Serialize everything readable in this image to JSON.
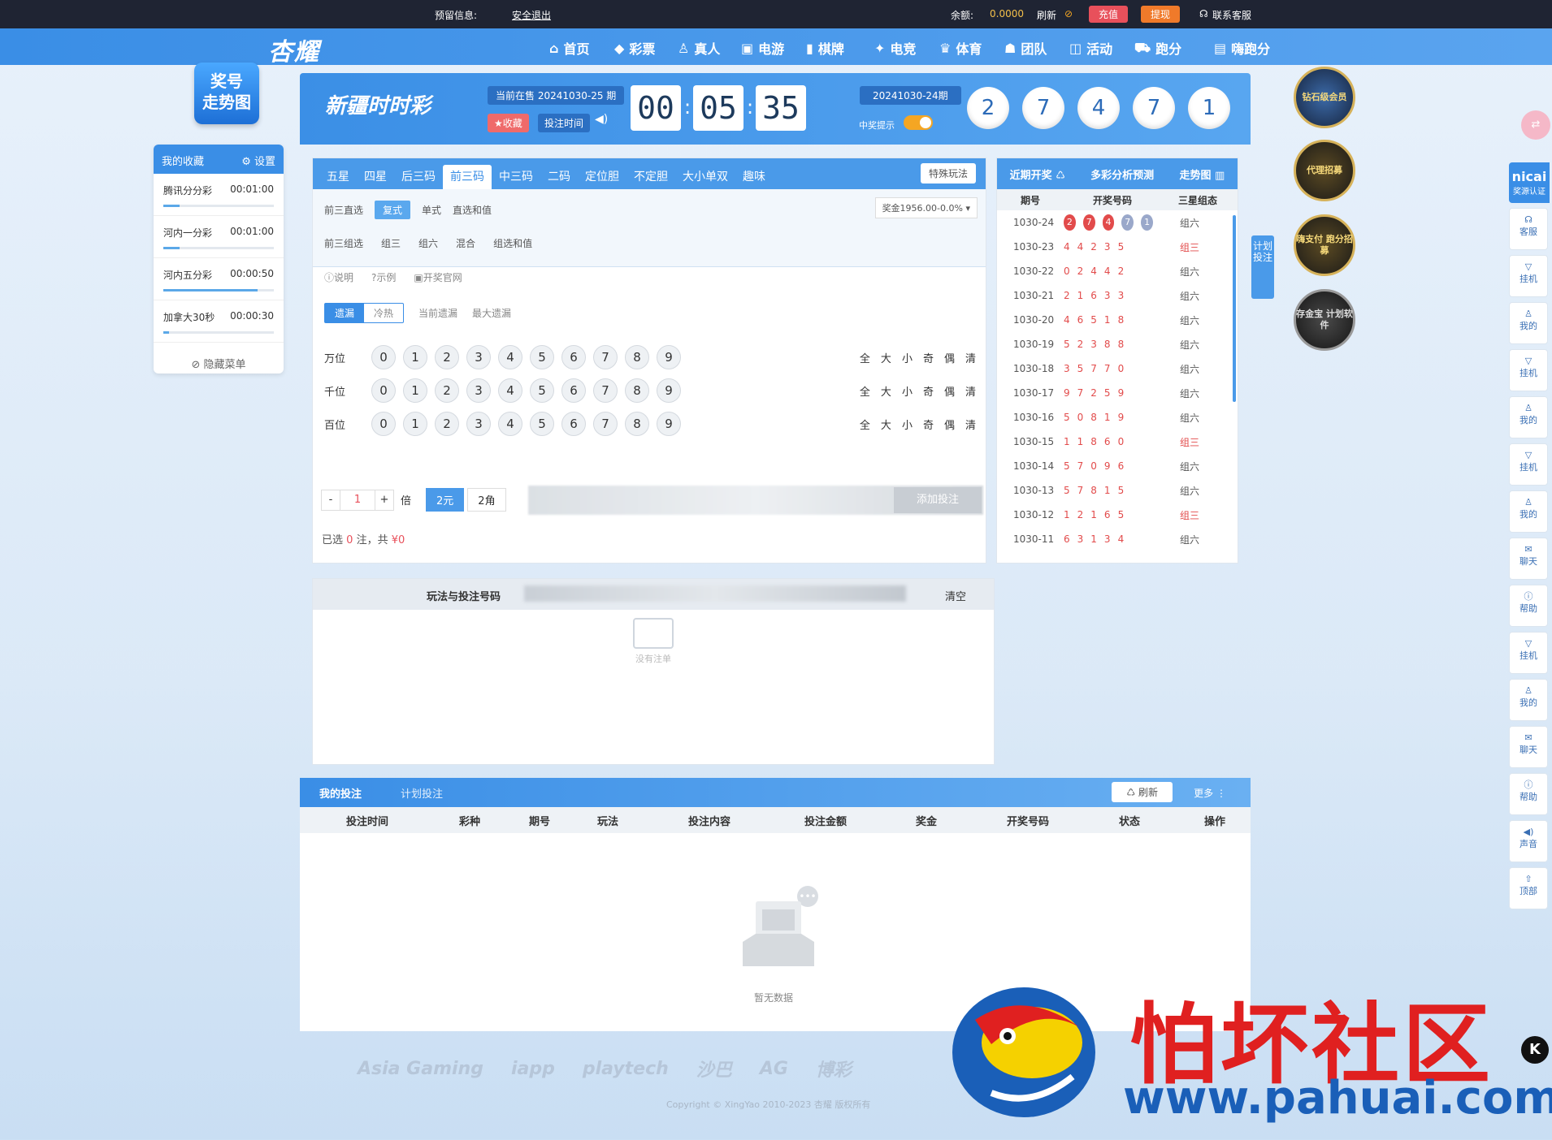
{
  "topbar": {
    "notice_label": "预留信息:",
    "logout": "安全退出",
    "balance_label": "余额:",
    "balance_value": "0.0000",
    "refresh": "刷新",
    "recharge": "充值",
    "withdraw": "提现",
    "service": "联系客服"
  },
  "nav": {
    "logo": "杏耀",
    "items": [
      "首页",
      "彩票",
      "真人",
      "电游",
      "棋牌",
      "电竞",
      "体育",
      "团队",
      "活动",
      "跑分",
      "嗨跑分"
    ]
  },
  "trend_badge": {
    "line1": "奖号",
    "line2": "走势图"
  },
  "favorites": {
    "title": "我的收藏",
    "settings": "设置",
    "items": [
      {
        "name": "腾讯分分彩",
        "time": "00:01:00",
        "progress": 0.15
      },
      {
        "name": "河内一分彩",
        "time": "00:01:00",
        "progress": 0.15
      },
      {
        "name": "河内五分彩",
        "time": "00:00:50",
        "progress": 0.85
      },
      {
        "name": "加拿大30秒",
        "time": "00:00:30",
        "progress": 0.05
      }
    ],
    "hide_menu": "隐藏菜单"
  },
  "lottery": {
    "name": "新疆时时彩",
    "current_issue": "当前在售 20241030-25 期",
    "fav_tag": "收藏",
    "bet_time_tag": "投注时间",
    "countdown": [
      "00",
      "05",
      "35"
    ],
    "last_issue": "20241030-24期",
    "win_hint": "中奖提示",
    "balls": [
      "2",
      "7",
      "4",
      "7",
      "1"
    ]
  },
  "play": {
    "tabs": [
      "五星",
      "四星",
      "后三码",
      "前三码",
      "中三码",
      "二码",
      "定位胆",
      "不定胆",
      "大小单双",
      "趣味"
    ],
    "active_tab": "前三码",
    "special": "特殊玩法",
    "row1_label": "前三直选",
    "row1": [
      "复式",
      "单式",
      "直选和值"
    ],
    "row2_label": "前三组选",
    "row2": [
      "组三",
      "组六",
      "混合",
      "组选和值"
    ],
    "prize": "奖金1956.00-0.0%",
    "help": [
      "说明",
      "示例",
      "开奖官网"
    ],
    "miss_seg": [
      "遗漏",
      "冷热"
    ],
    "miss_opts": [
      "当前遗漏",
      "最大遗漏"
    ],
    "positions": [
      "万位",
      "千位",
      "百位"
    ],
    "digits": [
      "0",
      "1",
      "2",
      "3",
      "4",
      "5",
      "6",
      "7",
      "8",
      "9"
    ],
    "quick": [
      "全",
      "大",
      "小",
      "奇",
      "偶",
      "清"
    ],
    "minus": "-",
    "multiplier": "1",
    "plus": "+",
    "times": "倍",
    "units": [
      "2元",
      "2角"
    ],
    "add_bet": "添加投注",
    "selected_prefix": "已选",
    "selected_count": "0",
    "selected_mid": "注，共",
    "selected_amount": "¥0"
  },
  "cart": {
    "header": "玩法与投注号码",
    "clear": "清空",
    "empty": "没有注单"
  },
  "recent": {
    "tabs": [
      "近期开奖",
      "多彩分析预测",
      "走势图"
    ],
    "headers": [
      "期号",
      "开奖号码",
      "三星组态"
    ],
    "rows": [
      {
        "issue": "1030-24",
        "nums": [
          "2",
          "7",
          "4",
          "7",
          "1"
        ],
        "state": "组六"
      },
      {
        "issue": "1030-23",
        "nums": [
          "4",
          "4",
          "2",
          "3",
          "5"
        ],
        "state": "组三"
      },
      {
        "issue": "1030-22",
        "nums": [
          "0",
          "2",
          "4",
          "4",
          "2"
        ],
        "state": "组六"
      },
      {
        "issue": "1030-21",
        "nums": [
          "2",
          "1",
          "6",
          "3",
          "3"
        ],
        "state": "组六"
      },
      {
        "issue": "1030-20",
        "nums": [
          "4",
          "6",
          "5",
          "1",
          "8"
        ],
        "state": "组六"
      },
      {
        "issue": "1030-19",
        "nums": [
          "5",
          "2",
          "3",
          "8",
          "8"
        ],
        "state": "组六"
      },
      {
        "issue": "1030-18",
        "nums": [
          "3",
          "5",
          "7",
          "7",
          "0"
        ],
        "state": "组六"
      },
      {
        "issue": "1030-17",
        "nums": [
          "9",
          "7",
          "2",
          "5",
          "9"
        ],
        "state": "组六"
      },
      {
        "issue": "1030-16",
        "nums": [
          "5",
          "0",
          "8",
          "1",
          "9"
        ],
        "state": "组六"
      },
      {
        "issue": "1030-15",
        "nums": [
          "1",
          "1",
          "8",
          "6",
          "0"
        ],
        "state": "组三"
      },
      {
        "issue": "1030-14",
        "nums": [
          "5",
          "7",
          "0",
          "9",
          "6"
        ],
        "state": "组六"
      },
      {
        "issue": "1030-13",
        "nums": [
          "5",
          "7",
          "8",
          "1",
          "5"
        ],
        "state": "组六"
      },
      {
        "issue": "1030-12",
        "nums": [
          "1",
          "2",
          "1",
          "6",
          "5"
        ],
        "state": "组三"
      },
      {
        "issue": "1030-11",
        "nums": [
          "6",
          "3",
          "1",
          "3",
          "4"
        ],
        "state": "组六"
      }
    ]
  },
  "plan_tab": "计划投注",
  "bets": {
    "tabs": [
      "我的投注",
      "计划投注"
    ],
    "refresh": "刷新",
    "more": "更多",
    "headers": [
      "投注时间",
      "彩种",
      "期号",
      "玩法",
      "投注内容",
      "投注金额",
      "奖金",
      "开奖号码",
      "状态",
      "操作"
    ],
    "empty": "暂无数据"
  },
  "badges": [
    "钻石级会员",
    "代理招募",
    "嗨支付 跑分招募",
    "存金宝 计划软件"
  ],
  "side": {
    "brand": "nicai",
    "brand_sub": "奖源认证",
    "tools": [
      "客服",
      "挂机",
      "我的",
      "挂机",
      "我的",
      "挂机",
      "我的",
      "聊天",
      "帮助",
      "挂机",
      "我的",
      "聊天",
      "帮助",
      "声音",
      "顶部"
    ]
  },
  "footer": {
    "logos": [
      "Asia Gaming",
      "iapp",
      "playtech",
      "沙巴",
      "AG",
      "博彩"
    ],
    "copyright": "Copyright © XingYao 2010-2023 杏耀 版权所有"
  },
  "watermark": {
    "text": "怕坏社区",
    "url": "www.pahuai.com",
    "k": "K"
  },
  "colors": {
    "primary": "#3a8ee6",
    "accent_red": "#e8505b",
    "accent_orange": "#f07a2a",
    "dark": "#1f2433"
  }
}
